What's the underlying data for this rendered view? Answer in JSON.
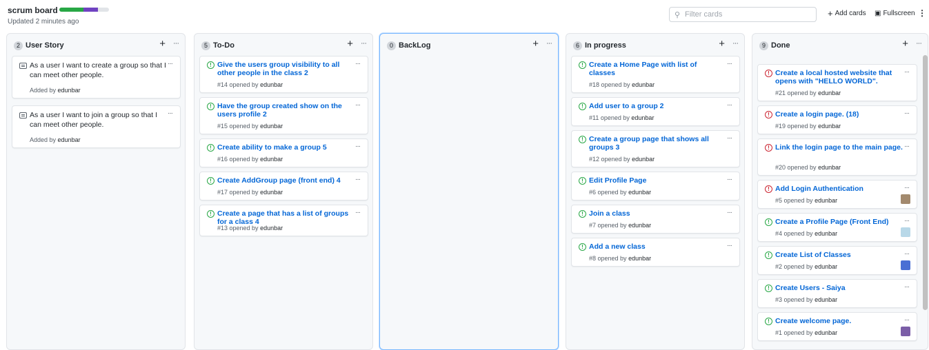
{
  "header": {
    "title": "scrum board",
    "updated": "Updated 2 minutes ago",
    "progress": {
      "done_fraction": 0.48,
      "in_progress_fraction": 0.3,
      "done_color": "#28a745",
      "progress_color": "#6f42c1"
    },
    "filter_placeholder": "Filter cards",
    "add_cards": "Add cards",
    "fullscreen": "Fullscreen",
    "more": "⋮"
  },
  "columns": [
    {
      "count": "2",
      "name": "User Story",
      "cards": [
        {
          "type": "note",
          "title": "As a user I want to create a group so that I can meet other people.",
          "meta_prefix": "Added by",
          "author": "edunbar"
        },
        {
          "type": "note",
          "title": "As a user I want to join a group so that I can meet other people.",
          "meta_prefix": "Added by",
          "author": "edunbar"
        }
      ]
    },
    {
      "count": "5",
      "name": "To-Do",
      "cards": [
        {
          "type": "open",
          "title": "Give the users group visibility to all other people in the class 2",
          "meta_prefix": "#14 opened by",
          "author": "edunbar"
        },
        {
          "type": "open",
          "title": "Have the group created show on the users profile 2",
          "meta_prefix": "#15 opened by",
          "author": "edunbar"
        },
        {
          "type": "open",
          "title": "Create ability to make a group 5",
          "meta_prefix": "#16 opened by",
          "author": "edunbar"
        },
        {
          "type": "open",
          "title": "Create AddGroup page (front end) 4",
          "meta_prefix": "#17 opened by",
          "author": "edunbar"
        },
        {
          "type": "open",
          "title": "Create a page that has a list of groups for a class 4",
          "meta_prefix": "#13 opened by",
          "author": "edunbar"
        }
      ]
    },
    {
      "count": "0",
      "name": "BackLog",
      "cards": []
    },
    {
      "count": "6",
      "name": "In progress",
      "cards": [
        {
          "type": "open",
          "title": "Create a Home Page with list of classes",
          "meta_prefix": "#18 opened by",
          "author": "edunbar"
        },
        {
          "type": "open",
          "title": "Add user to a group 2",
          "meta_prefix": "#11 opened by",
          "author": "edunbar"
        },
        {
          "type": "open",
          "title": "Create a group page that shows all groups 3",
          "meta_prefix": "#12 opened by",
          "author": "edunbar"
        },
        {
          "type": "open",
          "title": "Edit Profile Page",
          "meta_prefix": "#6 opened by",
          "author": "edunbar"
        },
        {
          "type": "open",
          "title": "Join a class",
          "meta_prefix": "#7 opened by",
          "author": "edunbar"
        },
        {
          "type": "open",
          "title": "Add a new class",
          "meta_prefix": "#8 opened by",
          "author": "edunbar"
        }
      ]
    },
    {
      "count": "9",
      "name": "Done",
      "cards": [
        {
          "type": "closed",
          "title": "Create a local hosted website that opens with \"HELLO WORLD\".",
          "meta_prefix": "#21 opened by",
          "author": "edunbar"
        },
        {
          "type": "closed",
          "title": "Create a login page. (18)",
          "meta_prefix": "#19 opened by",
          "author": "edunbar"
        },
        {
          "type": "closed",
          "title": "Link the login page to the main page.",
          "meta_prefix": "#20 opened by",
          "author": "edunbar"
        },
        {
          "type": "closed",
          "title": "Add Login Authentication",
          "meta_prefix": "#5 opened by",
          "author": "edunbar",
          "avatar": "#a38a6e"
        },
        {
          "type": "open",
          "title": "Create a Profile Page (Front End)",
          "meta_prefix": "#4 opened by",
          "author": "edunbar",
          "avatar": "#b8d8e8"
        },
        {
          "type": "open",
          "title": "Create List of Classes",
          "meta_prefix": "#2 opened by",
          "author": "edunbar",
          "avatar": "#4a6fd4"
        },
        {
          "type": "open",
          "title": "Create Users - Saiya",
          "meta_prefix": "#3 opened by",
          "author": "edunbar"
        },
        {
          "type": "open",
          "title": "Create welcome page.",
          "meta_prefix": "#1 opened by",
          "author": "edunbar",
          "avatar": "#7b5ea7"
        }
      ]
    }
  ],
  "icons": {
    "add": "plus-icon",
    "more": "ellipsis-icon",
    "open": "issue-opened-icon",
    "closed": "issue-closed-icon",
    "note": "note-icon"
  }
}
